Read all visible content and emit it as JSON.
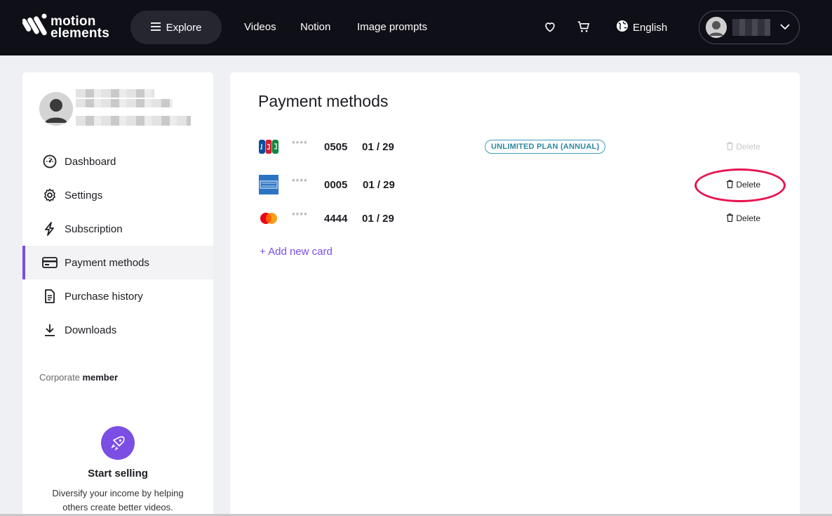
{
  "header": {
    "logo_line1": "motion",
    "logo_line2": "elements",
    "explore_label": "Explore",
    "nav": [
      "Videos",
      "Notion",
      "Image prompts"
    ],
    "language": "English"
  },
  "sidebar": {
    "menu": [
      {
        "label": "Dashboard",
        "icon": "dashboard-icon"
      },
      {
        "label": "Settings",
        "icon": "gear-icon"
      },
      {
        "label": "Subscription",
        "icon": "lightning-icon"
      },
      {
        "label": "Payment methods",
        "icon": "credit-card-icon",
        "active": true
      },
      {
        "label": "Purchase history",
        "icon": "receipt-icon"
      },
      {
        "label": "Downloads",
        "icon": "download-icon"
      }
    ],
    "member_prefix": "Corporate",
    "member_suffix": "member",
    "sell_title": "Start selling",
    "sell_desc": "Diversify your income by helping others create better videos."
  },
  "main": {
    "title": "Payment methods",
    "cards": [
      {
        "brand": "JCB",
        "mask": "****",
        "last4": "0505",
        "expiry": "01 / 29",
        "badge": "UNLIMITED PLAN (ANNUAL)",
        "delete_label": "Delete",
        "delete_enabled": false
      },
      {
        "brand": "American Express",
        "mask": "****",
        "last4": "0005",
        "expiry": "01 / 29",
        "badge": "",
        "delete_label": "Delete",
        "delete_enabled": true
      },
      {
        "brand": "Mastercard",
        "mask": "****",
        "last4": "4444",
        "expiry": "01 / 29",
        "badge": "",
        "delete_label": "Delete",
        "delete_enabled": true
      }
    ],
    "add_card_label": "+ Add new card"
  },
  "colors": {
    "header_bg": "#0f0f17",
    "accent": "#7b4ee4",
    "badge": "#2f87a0",
    "highlight": "#e8124f"
  }
}
